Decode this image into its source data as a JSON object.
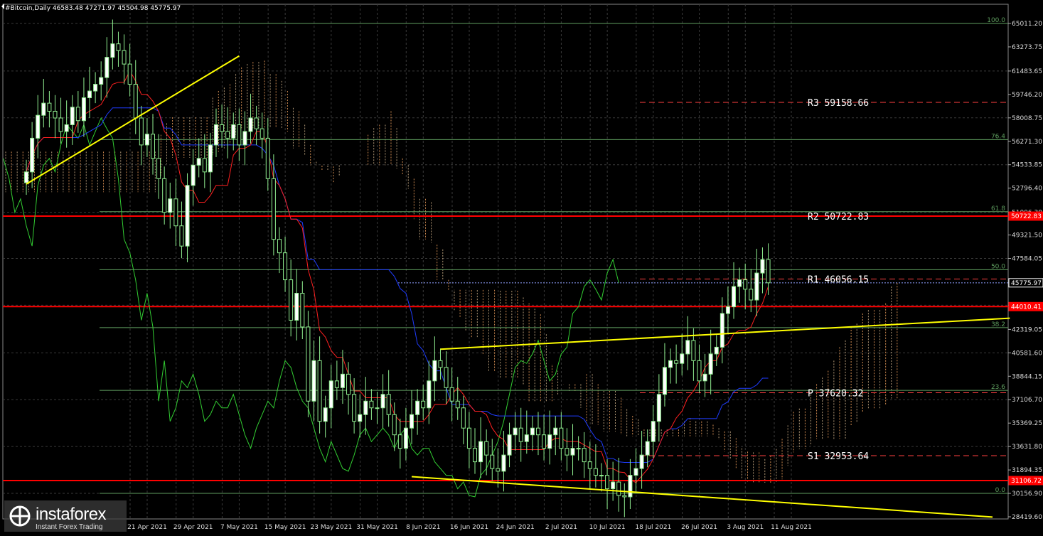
{
  "header": {
    "symbol_label": "#Bitcoin,Daily",
    "ohlc": "46583.48 47271.97 45504.98 45775.97"
  },
  "colors": {
    "background": "#000000",
    "grid": "#3a3a3a",
    "bull_candle": "#ffffff",
    "bear_candle": "#000000",
    "candle_outline": "#90ee90",
    "tenkan": "#ff2020",
    "kijun": "#1f3cff",
    "chikou": "#32cd32",
    "cloud_a": "#f4a460",
    "cloud_b": "#d2b48c",
    "support_resistance": "#ff0000",
    "trendline": "#ffff00",
    "fibo": "#5f9e5f"
  },
  "chart_data": {
    "type": "candlestick",
    "title": "#Bitcoin,Daily",
    "ylim": [
      28419.6,
      65700
    ],
    "y_ticks": [
      65011.2,
      63273.75,
      61483.65,
      59746.2,
      58008.75,
      56271.3,
      54533.85,
      52796.4,
      51006.3,
      49321.5,
      47584.05,
      45775.97,
      44109.15,
      42319.05,
      40581.6,
      38844.15,
      37106.7,
      35369.25,
      33631.8,
      31894.35,
      30156.9,
      28419.6
    ],
    "y_tick_labels": [
      "65011.20",
      "63273.75",
      "61483.65",
      "59746.20",
      "58008.75",
      "56271.30",
      "54533.85",
      "52796.40",
      "51006.30",
      "49321.50",
      "47584.05",
      "45775.97",
      "44109.15",
      "42319.05",
      "40581.60",
      "38844.15",
      "37106.70",
      "35369.25",
      "33631.80",
      "31894.35",
      "30156.90",
      "28419.60"
    ],
    "x_tick_labels": [
      "21 Apr 2021",
      "29 Apr 2021",
      "7 May 2021",
      "15 May 2021",
      "23 May 2021",
      "31 May 2021",
      "8 Jun 2021",
      "16 Jun 2021",
      "24 Jun 2021",
      "2 Jul 2021",
      "10 Jul 2021",
      "18 Jul 2021",
      "26 Jul 2021",
      "3 Aug 2021",
      "11 Aug 2021"
    ],
    "x_tick_day_index": [
      22,
      30,
      38,
      46,
      54,
      62,
      70,
      78,
      86,
      94,
      102,
      110,
      118,
      126,
      134
    ],
    "price_markers": [
      {
        "value": 50722.83,
        "label": "50722.83",
        "color": "#ff0000"
      },
      {
        "value": 44010.41,
        "label": "44010.41",
        "color": "#ff0000"
      },
      {
        "value": 31106.72,
        "label": "31106.72",
        "color": "#ff0000"
      },
      {
        "value": 45775.97,
        "label": "45775.97",
        "color": "#ffffff"
      }
    ],
    "pivots": [
      {
        "name": "R3",
        "value": 59158.66,
        "label": "R3 59158.66"
      },
      {
        "name": "R2",
        "value": 50722.83,
        "label": "R2 50722.83"
      },
      {
        "name": "R1",
        "value": 46056.15,
        "label": "R1 46056.15"
      },
      {
        "name": "P",
        "value": 37620.32,
        "label": "P 37620.32"
      },
      {
        "name": "S1",
        "value": 32953.64,
        "label": "S1 32953.64"
      }
    ],
    "fibo_levels": [
      {
        "label": "100.0",
        "value": 65011.2
      },
      {
        "label": "76.4",
        "value": 56400.0
      },
      {
        "label": "61.8",
        "value": 51050.0
      },
      {
        "label": "50.0",
        "value": 46750.0
      },
      {
        "label": "38.2",
        "value": 42450.0
      },
      {
        "label": "23.6",
        "value": 37800.0
      },
      {
        "label": "0.0",
        "value": 30156.9
      }
    ],
    "horizontal_levels": [
      50722.83,
      44010.41,
      31106.72
    ],
    "closes": [
      54000,
      56500,
      58200,
      59100,
      58500,
      58000,
      57000,
      57500,
      58800,
      57800,
      59500,
      60000,
      60500,
      61000,
      62500,
      63500,
      63000,
      62000,
      60500,
      58000,
      56000,
      56800,
      55000,
      53500,
      51000,
      52000,
      50000,
      48500,
      53000,
      54500,
      55000,
      54000,
      56000,
      57500,
      57000,
      56500,
      57500,
      56000,
      57000,
      58000,
      57200,
      56500,
      53500,
      49000,
      48000,
      46000,
      43000,
      45000,
      42500,
      37000,
      40000,
      35500,
      36500,
      38500,
      38000,
      39000,
      37500,
      35500,
      36000,
      37000,
      36500,
      36500,
      37500,
      36000,
      34500,
      33500,
      35000,
      36000,
      37000,
      36500,
      38500,
      40000,
      39500,
      38000,
      37000,
      36500,
      35000,
      33500,
      32500,
      34000,
      33000,
      32000,
      31800,
      33000,
      34500,
      35000,
      34000,
      34500,
      35000,
      34500,
      33500,
      34500,
      35000,
      33500,
      33000,
      33500,
      33500,
      32500,
      32000,
      31500,
      31500,
      30500,
      31000,
      30000,
      29900,
      31500,
      32000,
      33000,
      34000,
      35500,
      37500,
      39500,
      40000,
      39800,
      40500,
      41500,
      40000,
      38500,
      39000,
      40500,
      41000,
      43500,
      44000,
      45500,
      46000,
      45300,
      44500,
      46500,
      47500,
      45775.97
    ],
    "trendlines": [
      {
        "from": [
          0,
          53100
        ],
        "to": [
          37,
          62600
        ]
      },
      {
        "from": [
          72,
          40850
        ],
        "to": [
          171,
          43150
        ]
      },
      {
        "from": [
          67,
          31400
        ],
        "to": [
          168,
          28400
        ]
      }
    ]
  },
  "logo": {
    "brand": "instaforex",
    "tagline": "Instant Forex Trading"
  }
}
